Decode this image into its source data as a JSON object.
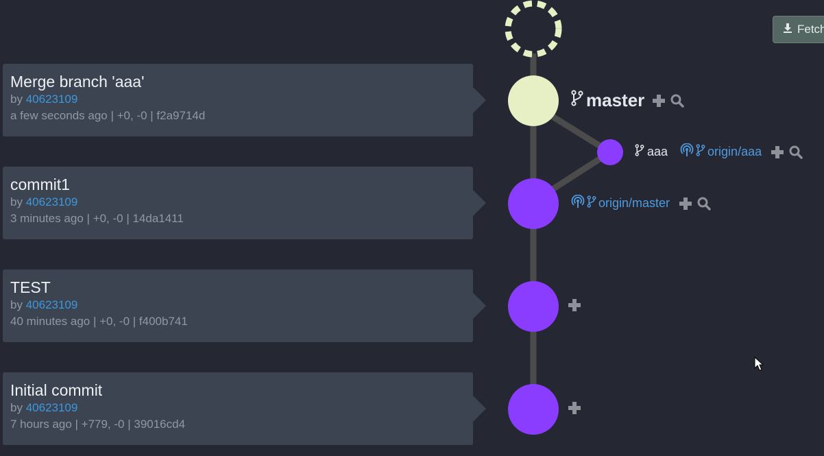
{
  "toolbar": {
    "fetch_label": "Fetch"
  },
  "commits": [
    {
      "title": "Merge branch 'aaa'",
      "by_prefix": "by",
      "author": "40623109",
      "meta": "a few seconds ago | +0, -0 | f2a9714d"
    },
    {
      "title": "commit1",
      "by_prefix": "by",
      "author": "40623109",
      "meta": "3 minutes ago | +0, -0 | 14da1411"
    },
    {
      "title": "TEST",
      "by_prefix": "by",
      "author": "40623109",
      "meta": "40 minutes ago | +0, -0 | f400b741"
    },
    {
      "title": "Initial commit",
      "by_prefix": "by",
      "author": "40623109",
      "meta": "7 hours ago | +779, -0 | 39016cd4"
    }
  ],
  "refs": {
    "master": "master",
    "aaa": "aaa",
    "origin_aaa": "origin/aaa",
    "origin_master": "origin/master"
  },
  "colors": {
    "background": "#252833",
    "card": "#3b4450",
    "head_node": "#e6f0c4",
    "commit_node": "#8a3cff",
    "edge": "#4b4b4b",
    "link": "#3f97dd",
    "pending_node": "#e6f0c4"
  },
  "icons": {
    "branch": "branch-icon",
    "remote": "remote-icon",
    "add": "plus-icon",
    "search": "search-icon",
    "download": "download-icon"
  }
}
